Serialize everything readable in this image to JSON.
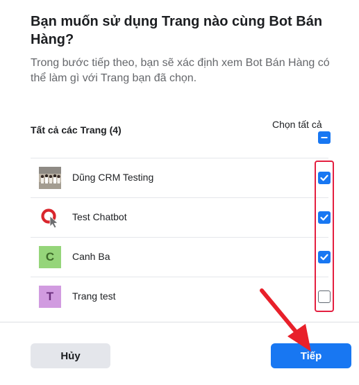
{
  "dialog": {
    "title": "Bạn muốn sử dụng Trang nào cùng Bot Bán Hàng?",
    "subtitle": "Trong bước tiếp theo, bạn sẽ xác định xem Bot Bán Hàng có thể làm gì với Trang bạn đã chọn."
  },
  "list": {
    "all_pages_label": "Tất cả các Trang (4)",
    "select_all_label": "Chọn tất cả",
    "select_all_state": "indeterminate",
    "pages": [
      {
        "name": "Dũng CRM Testing",
        "avatar": "group-photo",
        "checked": true
      },
      {
        "name": "Test Chatbot",
        "avatar": "chatbot-logo-icon",
        "checked": true
      },
      {
        "name": "Canh Ba",
        "avatar_letter": "C",
        "avatar_color": "#95d57a",
        "checked": true
      },
      {
        "name": "Trang test",
        "avatar_letter": "T",
        "avatar_color": "#d19be0",
        "checked": false
      }
    ]
  },
  "footer": {
    "cancel_label": "Hủy",
    "next_label": "Tiếp"
  },
  "colors": {
    "primary": "#1877f2",
    "annotation_red": "#e41e3f"
  }
}
